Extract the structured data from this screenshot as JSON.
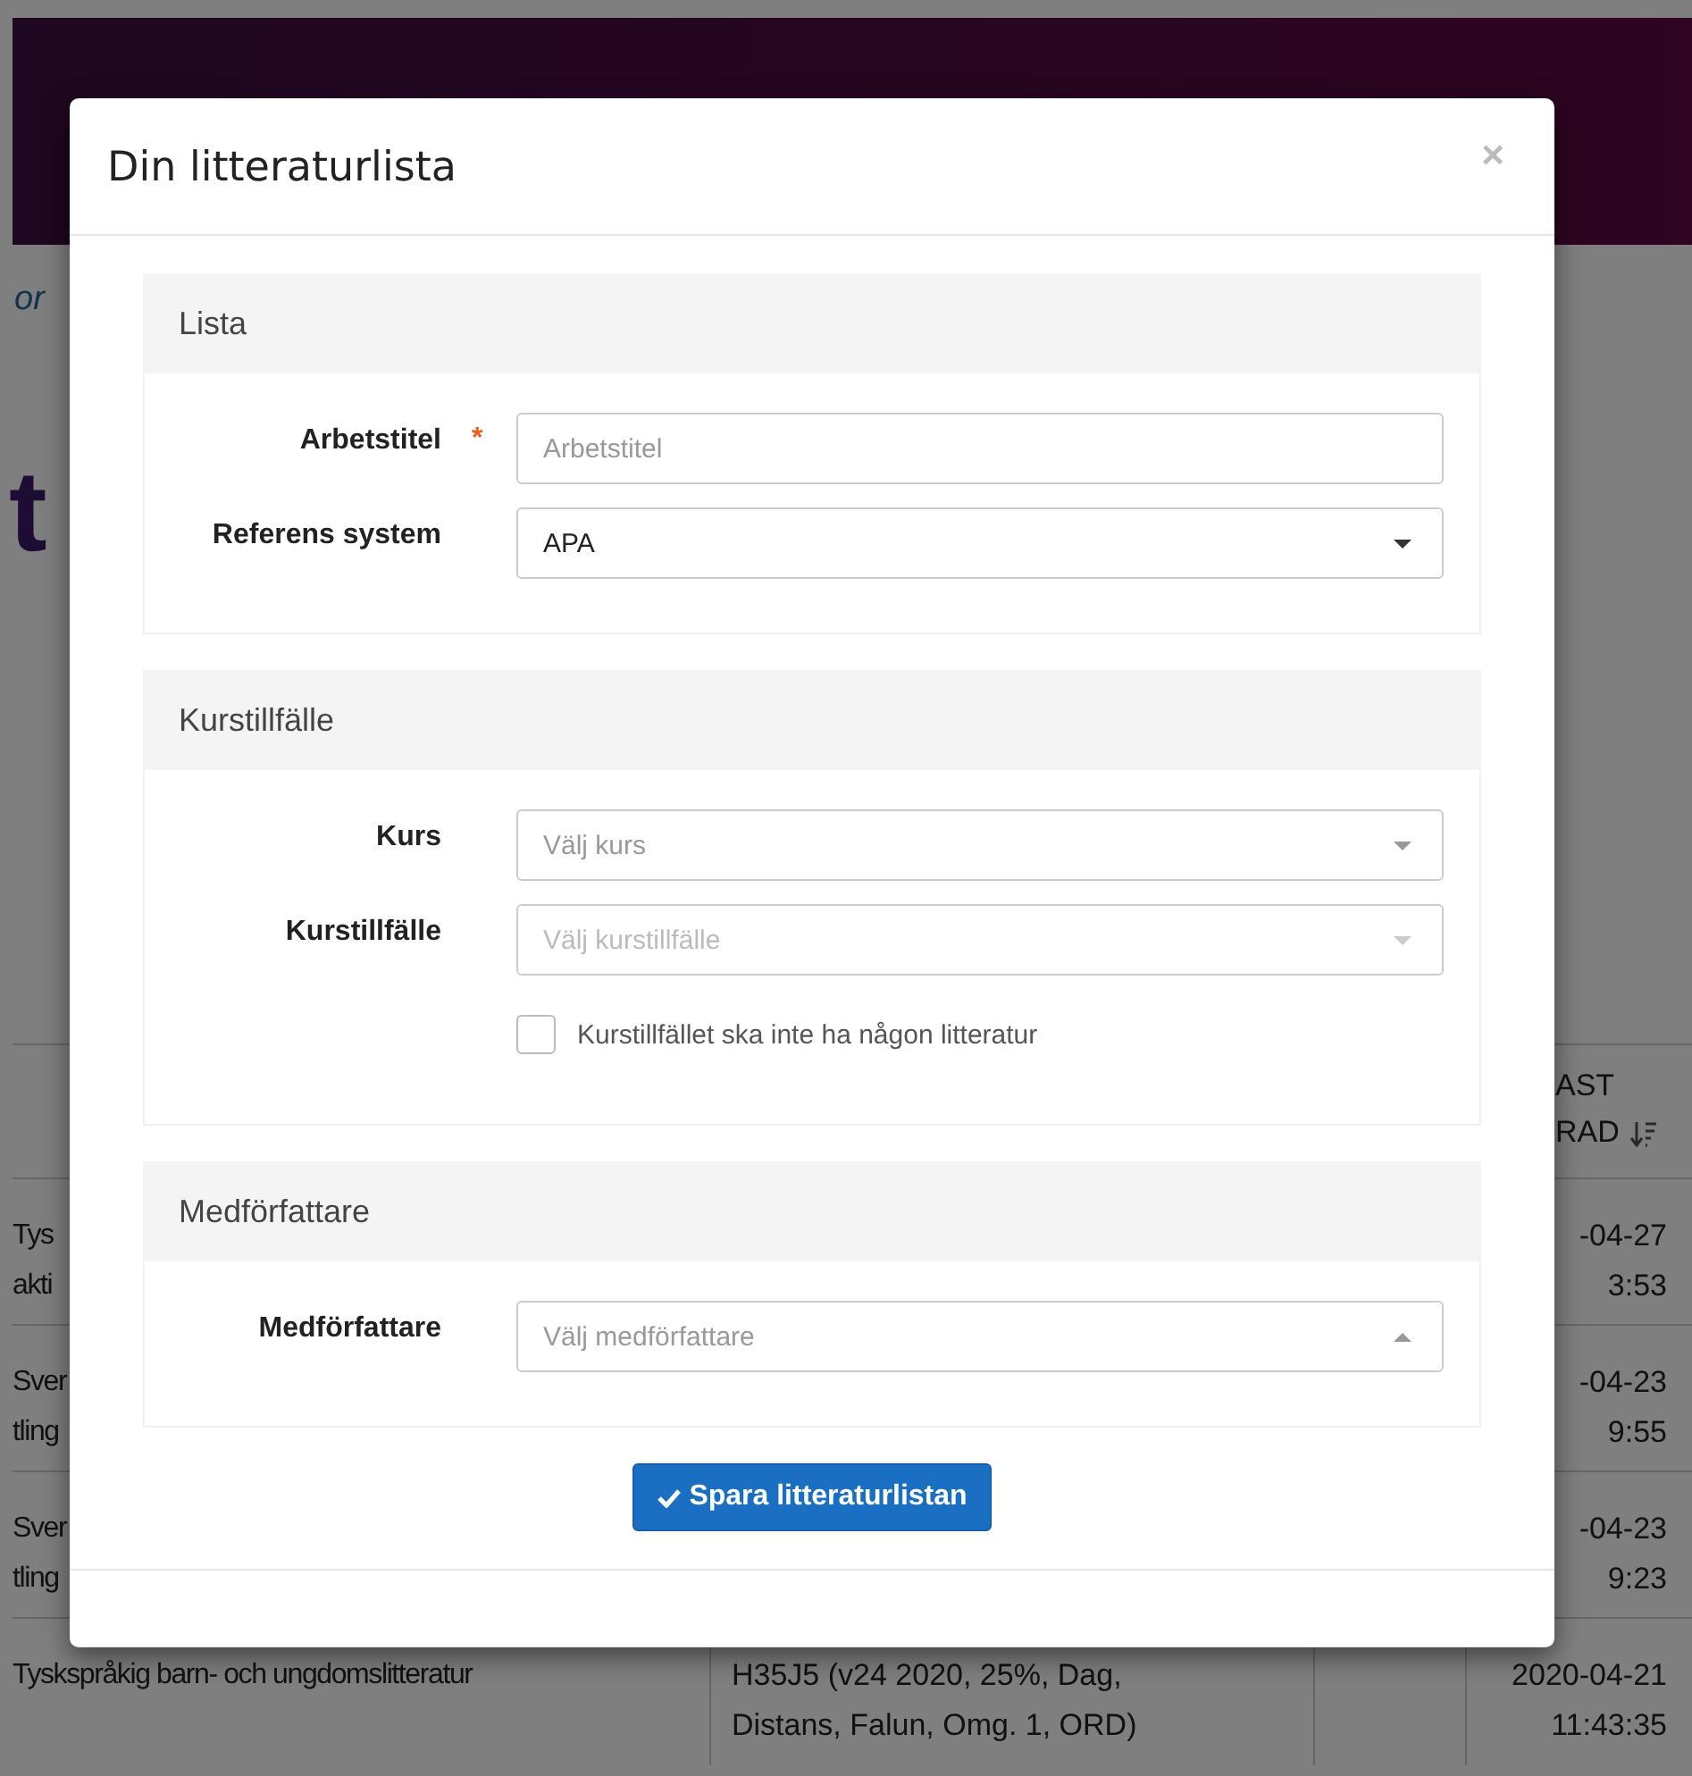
{
  "page": {
    "breadcrumb": "or",
    "heading": "t",
    "table": {
      "header": {
        "column_4": "AST\nRAD"
      },
      "rows": [
        {
          "column_1": "Tys\nakti",
          "column_4": "-04-27\n3:53"
        },
        {
          "column_1": "Sver\ntling",
          "column_4": "-04-23\n9:55"
        },
        {
          "column_1": "Sver\ntling",
          "column_4": "-04-23\n9:23"
        },
        {
          "column_1": "Tyskspråkig barn- och ungdomslitteratur",
          "column_2": "H35J5 (v24 2020, 25%, Dag,\nDistans, Falun, Omg. 1, ORD)",
          "column_4": "2020-04-21\n11:43:35"
        }
      ]
    }
  },
  "modal": {
    "title": "Din litteraturlista",
    "close": "×",
    "required_mark": "*",
    "sections": [
      {
        "title": "Lista",
        "fields": [
          {
            "kind": "text",
            "label": "Arbetstitel",
            "required": true,
            "placeholder": "Arbetstitel"
          },
          {
            "kind": "select",
            "label": "Referens system",
            "required": false,
            "value": "APA",
            "disabled": false,
            "open": false
          }
        ]
      },
      {
        "title": "Kurstillfälle",
        "fields": [
          {
            "kind": "select",
            "label": "Kurs",
            "required": false,
            "placeholder": "Välj kurs",
            "disabled": false,
            "open": false
          },
          {
            "kind": "select",
            "label": "Kurstillfälle",
            "required": false,
            "placeholder": "Välj kurstillfälle",
            "disabled": true,
            "open": false
          },
          {
            "kind": "checkbox",
            "label": "Kurstillfället ska inte ha någon litteratur",
            "checked": false
          }
        ]
      },
      {
        "title": "Medförfattare",
        "fields": [
          {
            "kind": "select",
            "label": "Medförfattare",
            "required": false,
            "placeholder": "Välj medförfattare",
            "disabled": false,
            "open": true
          }
        ]
      }
    ],
    "save_button": "Spara litteraturlistan"
  }
}
